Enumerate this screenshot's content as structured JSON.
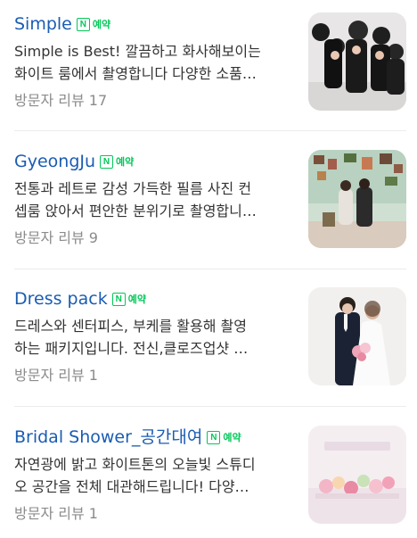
{
  "npay_label": "예약",
  "items": [
    {
      "title": "Simple",
      "desc_line1": "Simple is Best! 깔끔하고 화사해보이는",
      "desc_line2": "화이트 룸에서 촬영합니다 다양한 소품…",
      "review": "방문자 리뷰 17"
    },
    {
      "title": "GyeongJu",
      "desc_line1": "전통과 레트로 감성 가득한 필름 사진 컨",
      "desc_line2": "셉룸 앉아서 편안한 분위기로 촬영합니…",
      "review": "방문자 리뷰 9"
    },
    {
      "title": "Dress pack",
      "desc_line1": "드레스와 센터피스, 부케를 활용해 촬영",
      "desc_line2": "하는 패키지입니다. 전신,클로즈업샷 …",
      "review": "방문자 리뷰 1"
    },
    {
      "title": "Bridal Shower_공간대여",
      "desc_line1": "자연광에 밝고 화이트톤의 오늘빛 스튜디",
      "desc_line2": "오 공간을 전체 대관해드립니다! 다양…",
      "review": "방문자 리뷰 1"
    }
  ],
  "colors": {
    "title": "#1a5cb3",
    "npay_green": "#03c75a",
    "desc": "#333333",
    "review": "#8b8b8b"
  }
}
